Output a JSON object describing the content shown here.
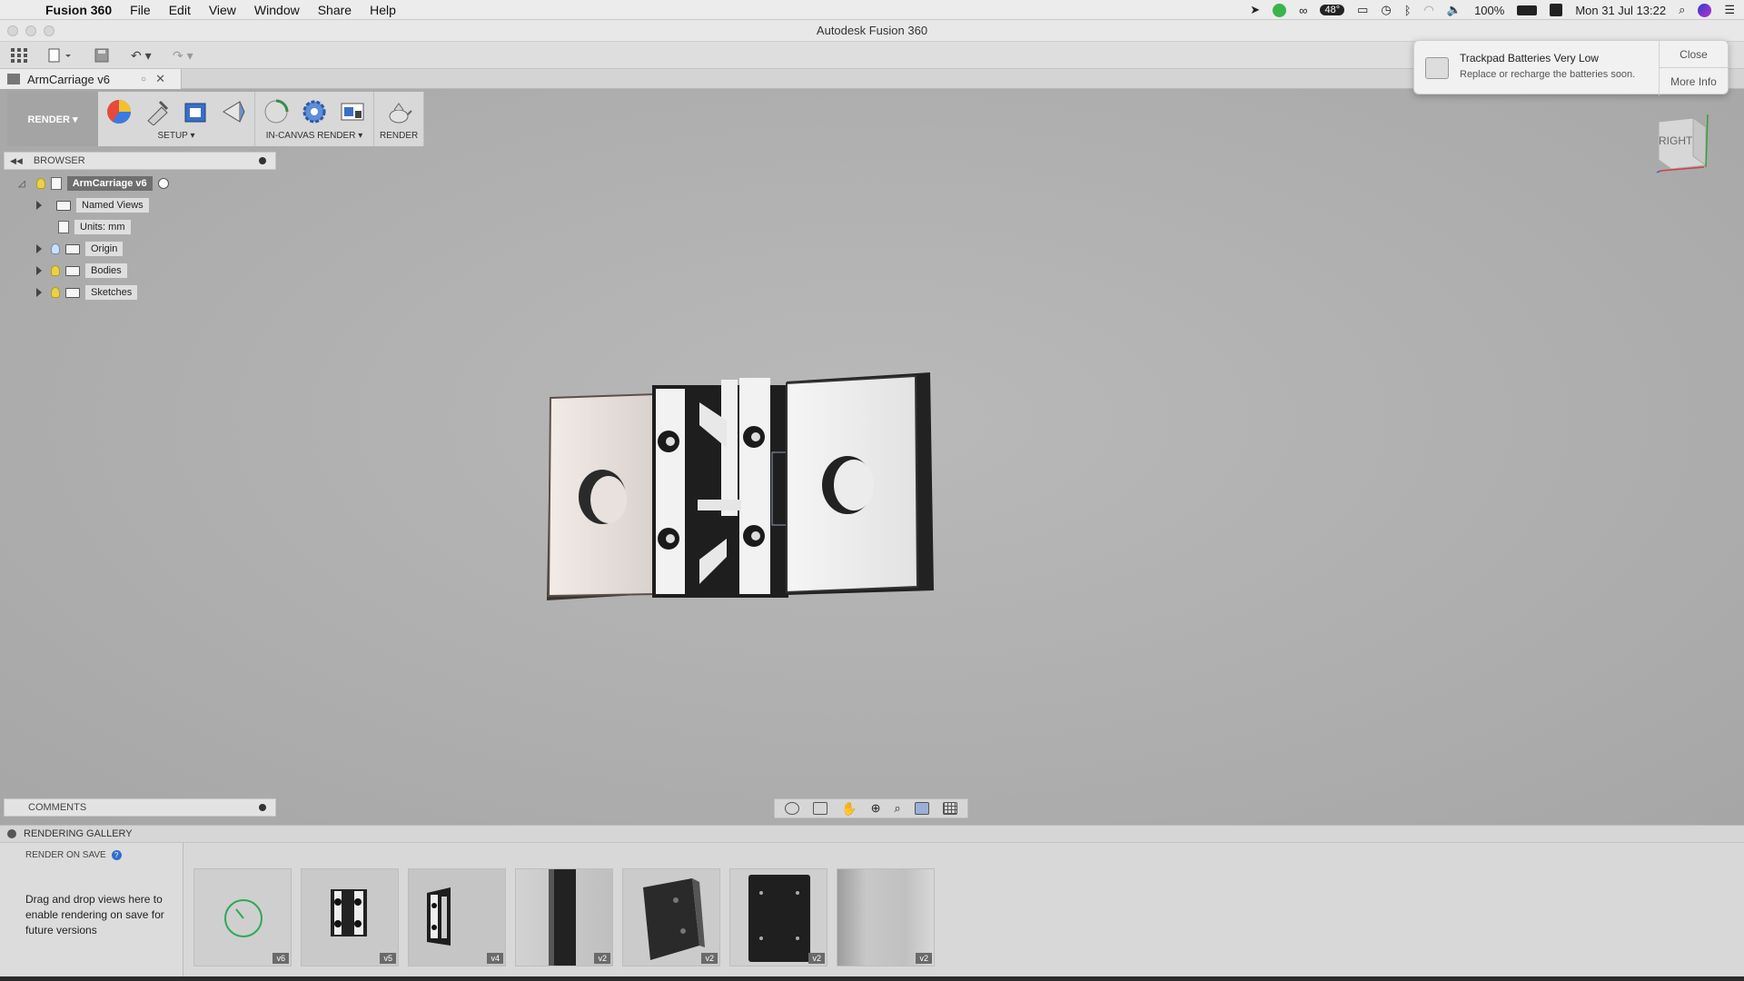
{
  "menubar": {
    "app_name": "Fusion 360",
    "items": [
      "File",
      "Edit",
      "View",
      "Window",
      "Share",
      "Help"
    ],
    "status": {
      "battery": "100%",
      "datetime": "Mon 31 Jul  13:22",
      "temperature": "48°"
    }
  },
  "window": {
    "title": "Autodesk Fusion 360"
  },
  "document_tab": {
    "label": "ArmCarriage v6"
  },
  "toolbar": {
    "workspace": "RENDER ▾",
    "groups": [
      {
        "label": "SETUP ▾"
      },
      {
        "label": "IN-CANVAS RENDER ▾"
      },
      {
        "label": "RENDER"
      }
    ]
  },
  "browser": {
    "title": "BROWSER",
    "root": "ArmCarriage v6",
    "items": [
      "Named Views",
      "Units: mm",
      "Origin",
      "Bodies",
      "Sketches"
    ]
  },
  "comments": {
    "title": "COMMENTS"
  },
  "viewcube": {
    "face": "RIGHT"
  },
  "gallery": {
    "title": "RENDERING GALLERY",
    "render_on_save": "RENDER ON SAVE",
    "help_text": "Drag and drop views here to enable rendering on save for future versions",
    "thumbnails": [
      {
        "version": "v6",
        "kind": "spinner"
      },
      {
        "version": "v5",
        "kind": "carriage"
      },
      {
        "version": "v4",
        "kind": "carriage"
      },
      {
        "version": "v2",
        "kind": "bar"
      },
      {
        "version": "v2",
        "kind": "plate"
      },
      {
        "version": "v2",
        "kind": "plate-front"
      },
      {
        "version": "v2",
        "kind": "blur"
      }
    ]
  },
  "notification": {
    "title": "Trackpad Batteries Very Low",
    "body": "Replace or recharge the batteries soon.",
    "close": "Close",
    "more": "More Info"
  }
}
